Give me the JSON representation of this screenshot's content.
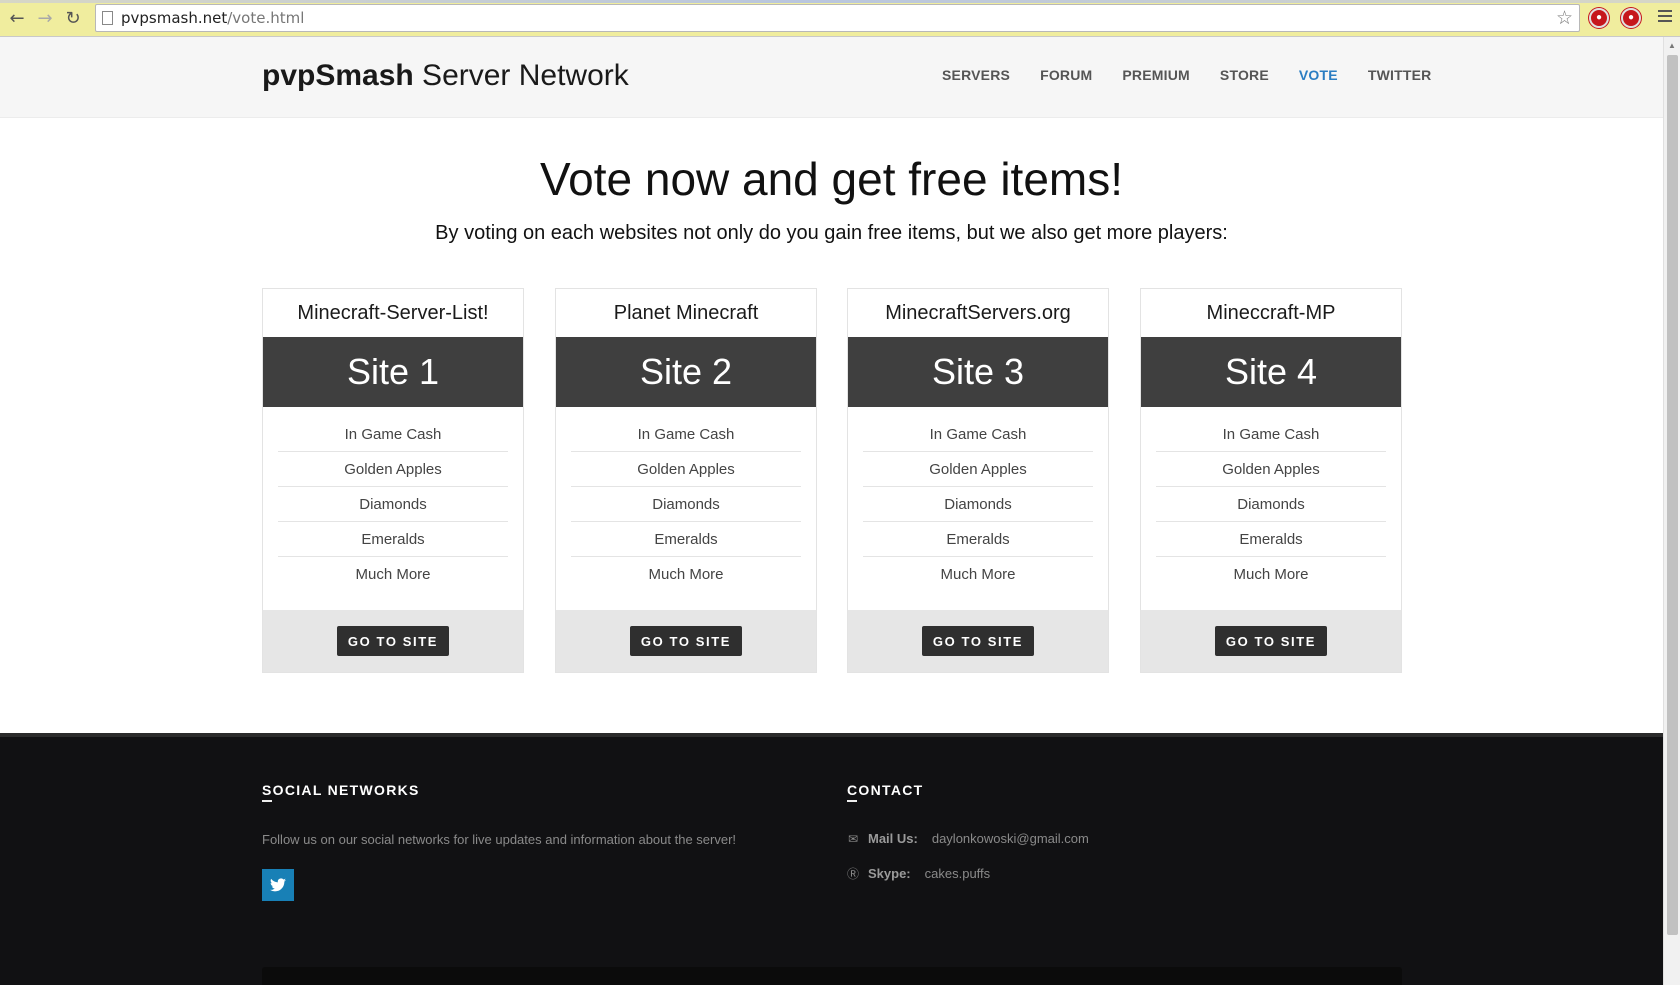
{
  "browser": {
    "url_host": "pvpsmash.net",
    "url_path": "/vote.html"
  },
  "header": {
    "brand_bold": "pvpSmash",
    "brand_rest": " Server Network",
    "nav": [
      {
        "label": "SERVERS"
      },
      {
        "label": "FORUM"
      },
      {
        "label": "PREMIUM"
      },
      {
        "label": "STORE"
      },
      {
        "label": "VOTE",
        "active": true
      },
      {
        "label": "TWITTER"
      }
    ]
  },
  "hero": {
    "title": "Vote now and get free items!",
    "subtitle": "By voting on each websites not only do you gain free items, but we also get more players:"
  },
  "cards": [
    {
      "name": "Minecraft-Server-List!",
      "site": "Site 1",
      "items": [
        "In Game Cash",
        "Golden Apples",
        "Diamonds",
        "Emeralds",
        "Much More"
      ],
      "button": "GO TO SITE"
    },
    {
      "name": "Planet Minecraft",
      "site": "Site 2",
      "items": [
        "In Game Cash",
        "Golden Apples",
        "Diamonds",
        "Emeralds",
        "Much More"
      ],
      "button": "GO TO SITE"
    },
    {
      "name": "MinecraftServers.org",
      "site": "Site 3",
      "items": [
        "In Game Cash",
        "Golden Apples",
        "Diamonds",
        "Emeralds",
        "Much More"
      ],
      "button": "GO TO SITE"
    },
    {
      "name": "Mineccraft-MP",
      "site": "Site 4",
      "items": [
        "In Game Cash",
        "Golden Apples",
        "Diamonds",
        "Emeralds",
        "Much More"
      ],
      "button": "GO TO SITE"
    }
  ],
  "footer": {
    "social_heading": "SOCIAL NETWORKS",
    "social_text": "Follow us on our social networks for live updates and information about the server!",
    "contact_heading": "CONTACT",
    "mail_label": "Mail Us:",
    "mail_value": "daylonkowoski@gmail.com",
    "skype_label": "Skype:",
    "skype_value": "cakes.puffs"
  },
  "colors": {
    "accent_nav": "#2a7dc2",
    "twitter": "#1880b6",
    "card_band": "#3f3f3f",
    "footer_bg": "#111113"
  }
}
